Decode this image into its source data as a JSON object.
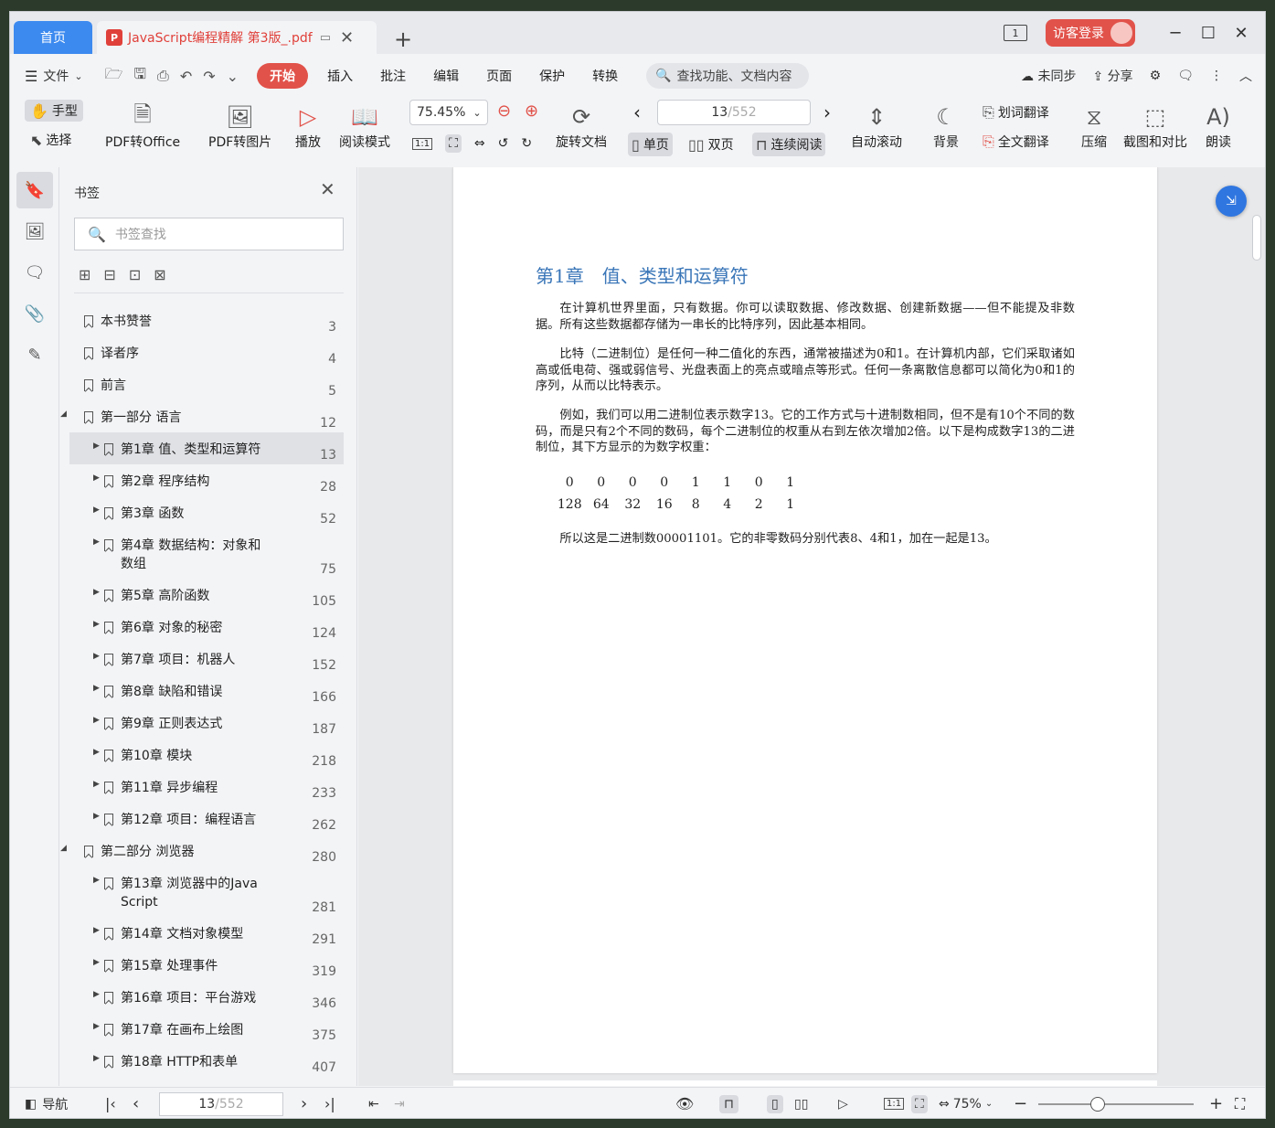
{
  "tabs": {
    "home": "首页",
    "document": "JavaScript编程精解 第3版_.pdf",
    "pdf_badge": "P"
  },
  "titlebar": {
    "layout_num": "1",
    "visitor_login": "访客登录"
  },
  "menu": {
    "file": "文件",
    "items": [
      "开始",
      "插入",
      "批注",
      "编辑",
      "页面",
      "保护",
      "转换"
    ],
    "search_placeholder": "查找功能、文档内容",
    "sync": "未同步",
    "share": "分享"
  },
  "ribbon": {
    "hand": "手型",
    "select": "选择",
    "pdf_to_office": "PDF转Office",
    "pdf_to_image": "PDF转图片",
    "play": "播放",
    "read_mode": "阅读模式",
    "zoom": "75.45%",
    "rotate_doc": "旋转文档",
    "page_current": "13",
    "page_total": "/552",
    "single_page": "单页",
    "double_page": "双页",
    "continuous": "连续阅读",
    "auto_scroll": "自动滚动",
    "background": "背景",
    "word_translate": "划词翻译",
    "full_translate": "全文翻译",
    "compress": "压缩",
    "screenshot_compare": "截图和对比",
    "read_aloud": "朗读",
    "fit_label": "1:1"
  },
  "bookmarks": {
    "title": "书签",
    "search_placeholder": "书签查找",
    "items": [
      {
        "label": "本书赞誉",
        "page": "3"
      },
      {
        "label": "译者序",
        "page": "4"
      },
      {
        "label": "前言",
        "page": "5"
      },
      {
        "label": "第一部分 语言",
        "page": "12"
      },
      {
        "label": "第1章 值、类型和运算符",
        "page": "13"
      },
      {
        "label": "第2章 程序结构",
        "page": "28"
      },
      {
        "label": "第3章 函数",
        "page": "52"
      },
      {
        "label": "第4章 数据结构：对象和\n数组",
        "page": "75"
      },
      {
        "label": "第5章 高阶函数",
        "page": "105"
      },
      {
        "label": "第6章 对象的秘密",
        "page": "124"
      },
      {
        "label": "第7章 项目：机器人",
        "page": "152"
      },
      {
        "label": "第8章 缺陷和错误",
        "page": "166"
      },
      {
        "label": "第9章 正则表达式",
        "page": "187"
      },
      {
        "label": "第10章 模块",
        "page": "218"
      },
      {
        "label": "第11章 异步编程",
        "page": "233"
      },
      {
        "label": "第12章 项目：编程语言",
        "page": "262"
      },
      {
        "label": "第二部分 浏览器",
        "page": "280"
      },
      {
        "label": "第13章 浏览器中的Java\nScript",
        "page": "281"
      },
      {
        "label": "第14章 文档对象模型",
        "page": "291"
      },
      {
        "label": "第15章 处理事件",
        "page": "319"
      },
      {
        "label": "第16章 项目：平台游戏",
        "page": "346"
      },
      {
        "label": "第17章 在画布上绘图",
        "page": "375"
      },
      {
        "label": "第18章 HTTP和表单",
        "page": "407"
      }
    ]
  },
  "page": {
    "chapter_title": "第1章　值、类型和运算符",
    "p1": "在计算机世界里面，只有数据。你可以读取数据、修改数据、创建新数据——但不能提及非数据。所有这些数据都存储为一串长的比特序列，因此基本相同。",
    "p2": "比特（二进制位）是任何一种二值化的东西，通常被描述为0和1。在计算机内部，它们采取诸如高或低电荷、强或弱信号、光盘表面上的亮点或暗点等形式。任何一条离散信息都可以简化为0和1的序列，从而以比特表示。",
    "p3": "例如，我们可以用二进制位表示数字13。它的工作方式与十进制数相同，但不是有10个不同的数码，而是只有2个不同的数码，每个二进制位的权重从右到左依次增加2倍。以下是构成数字13的二进制位，其下方显示的为数字权重：",
    "bits": [
      "0",
      "0",
      "0",
      "0",
      "1",
      "1",
      "0",
      "1"
    ],
    "weights": [
      "128",
      "64",
      "32",
      "16",
      "8",
      "4",
      "2",
      "1"
    ],
    "p4": "所以这是二进制数00001101。它的非零数码分别代表8、4和1，加在一起是13。"
  },
  "statusbar": {
    "nav": "导航",
    "page_current": "13",
    "page_total": "/552",
    "zoom": "75%",
    "fit_label": "1:1"
  }
}
